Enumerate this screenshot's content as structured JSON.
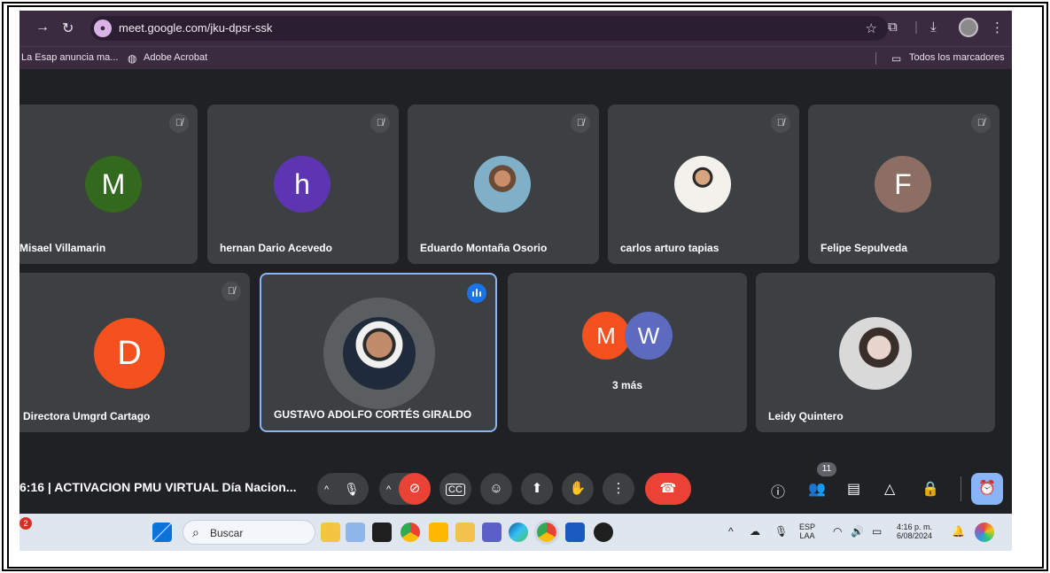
{
  "browser": {
    "url": "meet.google.com/jku-dpsr-ssk",
    "bookmarks": [
      "La Esap anuncia ma...",
      "Adobe Acrobat"
    ],
    "all_bookmarks": "Todos los marcadores"
  },
  "tiles_row1": [
    {
      "name": "Misael Villamarin",
      "initial": "M",
      "color": "#33691e",
      "muted": true,
      "kind": "letter"
    },
    {
      "name": "hernan Dario Acevedo",
      "initial": "h",
      "color": "#5e35b1",
      "muted": true,
      "kind": "letter"
    },
    {
      "name": "Eduardo Montaña Osorio",
      "initial": "",
      "color": "#5a8fa8",
      "muted": true,
      "kind": "photo"
    },
    {
      "name": "carlos arturo tapias",
      "initial": "",
      "color": "#e9e6df",
      "muted": true,
      "kind": "photo"
    },
    {
      "name": "Felipe Sepulveda",
      "initial": "F",
      "color": "#8d6e63",
      "muted": true,
      "kind": "letter"
    }
  ],
  "tiles_row2": [
    {
      "name": "Directora Umgrd Cartago",
      "initial": "D",
      "color": "#f4511e",
      "muted": true
    },
    {
      "name": "GUSTAVO ADOLFO CORTÉS GIRALDO",
      "speaking": true
    },
    {
      "name": "3 más",
      "initials": [
        "M",
        "W"
      ],
      "colors": [
        "#f4511e",
        "#5c6bc0"
      ]
    },
    {
      "name": "Leidy Quintero"
    }
  ],
  "meetbar": {
    "time_title": "6:16  |  ACTIVACION PMU VIRTUAL Día Nacion...",
    "participants_count": "11"
  },
  "taskbar": {
    "notification_count": "2",
    "search_placeholder": "Buscar",
    "lang_top": "ESP",
    "lang_bottom": "LAA",
    "time": "4:16 p. m.",
    "date": "6/08/2024"
  }
}
